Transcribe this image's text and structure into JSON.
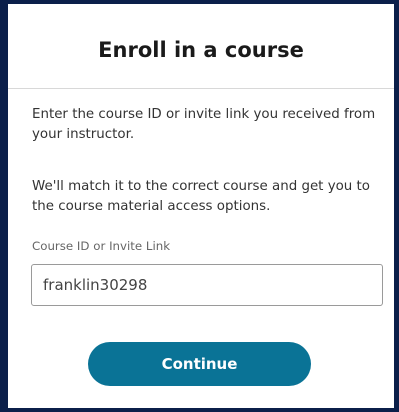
{
  "dialog": {
    "title": "Enroll in a course",
    "paragraph1": "Enter the course ID or invite link you received from your instructor.",
    "paragraph2": "We'll match it to the correct course and get you to the course material access options."
  },
  "course_field": {
    "label": "Course ID or Invite Link",
    "value": "franklin30298"
  },
  "actions": {
    "continue_label": "Continue"
  },
  "colors": {
    "primary_button": "#0a7396",
    "frame_border": "#0b1f4a"
  }
}
